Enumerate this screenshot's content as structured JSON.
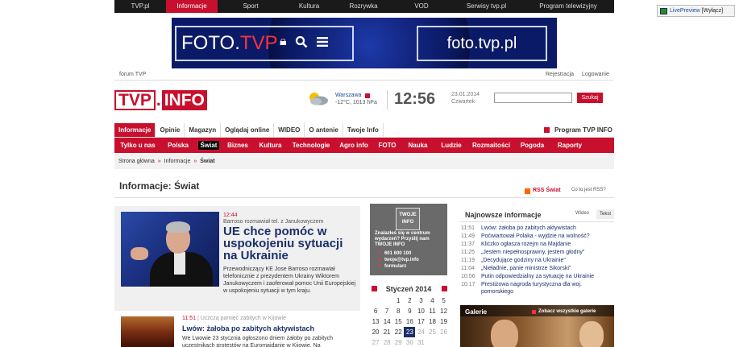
{
  "topnav": {
    "items": [
      {
        "label": "TVP.pl"
      },
      {
        "label": "Informacje",
        "active": true
      },
      {
        "label": "Sport"
      },
      {
        "label": "Kultura"
      },
      {
        "label": "Rozrywka"
      },
      {
        "label": "VOD"
      },
      {
        "label": "Serwisy tvp.pl"
      },
      {
        "label": "Program telewizyjny"
      }
    ]
  },
  "livepreview": {
    "name": "LivePreview",
    "action": "[Wyłącz]"
  },
  "banner": {
    "left_a": "FOTO.",
    "left_b": "TVP",
    "right": "foto.tvp.pl",
    "icons": [
      "lock-icon",
      "search-icon",
      "menu-icon"
    ]
  },
  "util": {
    "forum": "forum TVP",
    "register": "Rejestracja",
    "login": "Logowanie"
  },
  "logo": {
    "part1": "TVP",
    "dot": ".",
    "part2": "INFO"
  },
  "weather": {
    "city": "Warszawa",
    "details": "-12°C, 1013 hPa",
    "icon": "cloudy-icon"
  },
  "clock": {
    "time": "12:56",
    "date": "23.01.2014",
    "day": "Czwartek"
  },
  "search": {
    "placeholder": "",
    "button": "Szukaj"
  },
  "sectnav": {
    "items": [
      {
        "label": "Informacje",
        "active": true
      },
      {
        "label": "Opinie"
      },
      {
        "label": "Magazyn"
      },
      {
        "label": "Oglądaj online"
      },
      {
        "label": "WIDEO"
      },
      {
        "label": "O antenie"
      },
      {
        "label": "Twoje Info"
      }
    ],
    "program": "Program TVP INFO"
  },
  "subnav": {
    "items": [
      {
        "label": "Tylko u nas"
      },
      {
        "label": "Polska"
      },
      {
        "label": "Świat",
        "active": true
      },
      {
        "label": "Biznes"
      },
      {
        "label": "Kultura"
      },
      {
        "label": "Technologie"
      },
      {
        "label": "Agro info"
      },
      {
        "label": "FOTO"
      },
      {
        "label": "Nauka"
      },
      {
        "label": "Ludzie"
      },
      {
        "label": "Rozmaitości"
      },
      {
        "label": "Pogoda"
      },
      {
        "label": "Raporty"
      }
    ]
  },
  "breadcrumb": {
    "home": "Strona główna",
    "section": "Informacje",
    "current": "Świat",
    "sep": "»"
  },
  "page": {
    "title": "Informacje: Świat",
    "rss": "RSS Świat",
    "rss_what": "Co to jest RSS?"
  },
  "main_article": {
    "time": "12:44",
    "kicker": "Barroso rozmawiał tel. z Janukowyczem",
    "headline": "UE chce pomóc w uspokojeniu sytuacji na Ukrainie",
    "lead": "Przewodniczący KE Jose Barroso rozmawiał telefonicznie z prezydentem Ukrainy Wiktorem Janukowyczem i zaoferował pomoc Unii Europejskiej w uspokojeniu sytuacji w tym kraju."
  },
  "second_article": {
    "time": "11:51",
    "kicker": "Uczczą pamięć zabitych w Kijowie",
    "headline": "Lwów: żałoba po zabitych aktywistach",
    "lead": "We Lwowie 23 stycznia ogłoszono dniem żałoby po zabitych uczestnikach protestów na Euromajdanie w Kijowie. Na"
  },
  "twoje_info": {
    "logo_line1": "TWOJE",
    "logo_line2": "INFO",
    "text": "Znalazłeś się w centrum wydarzeń? Przyślij nam TWOJE INFO",
    "items": [
      "601 600 100",
      "twoje@tvp.info",
      "formularz"
    ]
  },
  "calendar": {
    "title": "Styczeń 2014",
    "today": 23,
    "rows": [
      [
        "",
        "",
        "1",
        "2",
        "3",
        "4",
        "5"
      ],
      [
        "6",
        "7",
        "8",
        "9",
        "10",
        "11",
        "12"
      ],
      [
        "13",
        "14",
        "15",
        "16",
        "17",
        "18",
        "19"
      ],
      [
        "20",
        "21",
        "22",
        "23",
        "24",
        "25",
        "26"
      ],
      [
        "27",
        "28",
        "29",
        "30",
        "31",
        "",
        ""
      ]
    ]
  },
  "newest": {
    "title": "Najnowsze informacje",
    "tab_video": "Wideo",
    "tab_text": "Tekst",
    "items": [
      {
        "time": "11:51",
        "text": "Lwów: żałoba po zabitych aktywistach"
      },
      {
        "time": "11:49",
        "text": "Poćwiartował Polaka - wyjdzie na wolność?"
      },
      {
        "time": "11:37",
        "text": "Kliczko ogłasza rozejm na Majdanie"
      },
      {
        "time": "11:25",
        "text": "„Jestem niepełnosprawny, jestem głodny\""
      },
      {
        "time": "11:19",
        "text": "„Decydujące godziny na Ukrainie\""
      },
      {
        "time": "11:04",
        "text": "„Nieładnie, panie ministrze Sikorski\""
      },
      {
        "time": "10:56",
        "text": "Putin odpowiedzialny za sytuację na Ukrainie"
      },
      {
        "time": "10:17",
        "text": "Prestiżowa nagroda turystyczna dla woj. pomorskiego"
      }
    ]
  },
  "gallery": {
    "title": "Galerie",
    "all": "Zobacz wszystkie galerie"
  }
}
